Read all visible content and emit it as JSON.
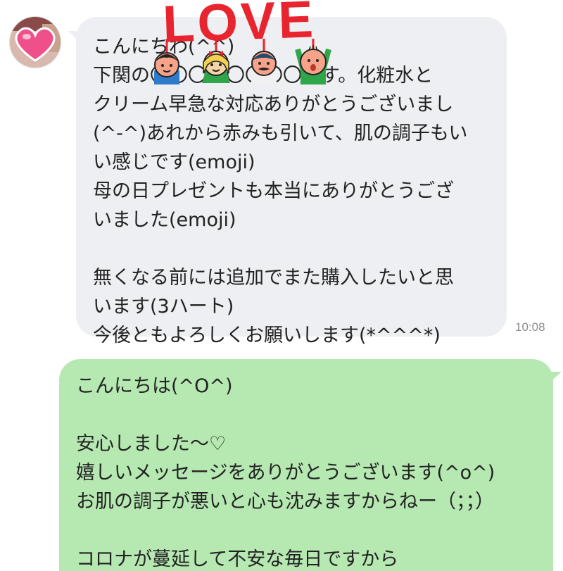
{
  "conversation": {
    "incoming": {
      "text": "こんにちわ(^^)\n下関の〇〇〇〇〇〇〇〇です。化粧水と\nクリーム早急な対応ありがとうございまし\n(^-^)あれから赤みも引いて、肌の調子もい\nい感じです(emoji)\n母の日プレゼントも本当にありがとうござ\nいました(emoji)\n\n無くなる前には追加でまた購入したいと思\nいます(3ハート)\n今後ともよろしくお願いします(*^^^*)",
      "time": "10:08"
    },
    "outgoing": {
      "text": "こんにちは(^O^)\n\n安心しました〜♡\n嬉しいメッセージをありがとうございます(^o^)\nお肌の調子が悪いと心も沈みますからねー（；；）\n\nコロナが蔓延して不安な毎日ですから\nせめてお肌の調子がよく気持ちを明るく持ちたい"
    }
  },
  "sticker": {
    "text": "LOVE",
    "color": "#e8252f"
  },
  "colors": {
    "incoming_bubble": "#eeeff2",
    "outgoing_bubble": "#b6e8b2"
  },
  "icons": {
    "avatar": "heart-avatar"
  }
}
